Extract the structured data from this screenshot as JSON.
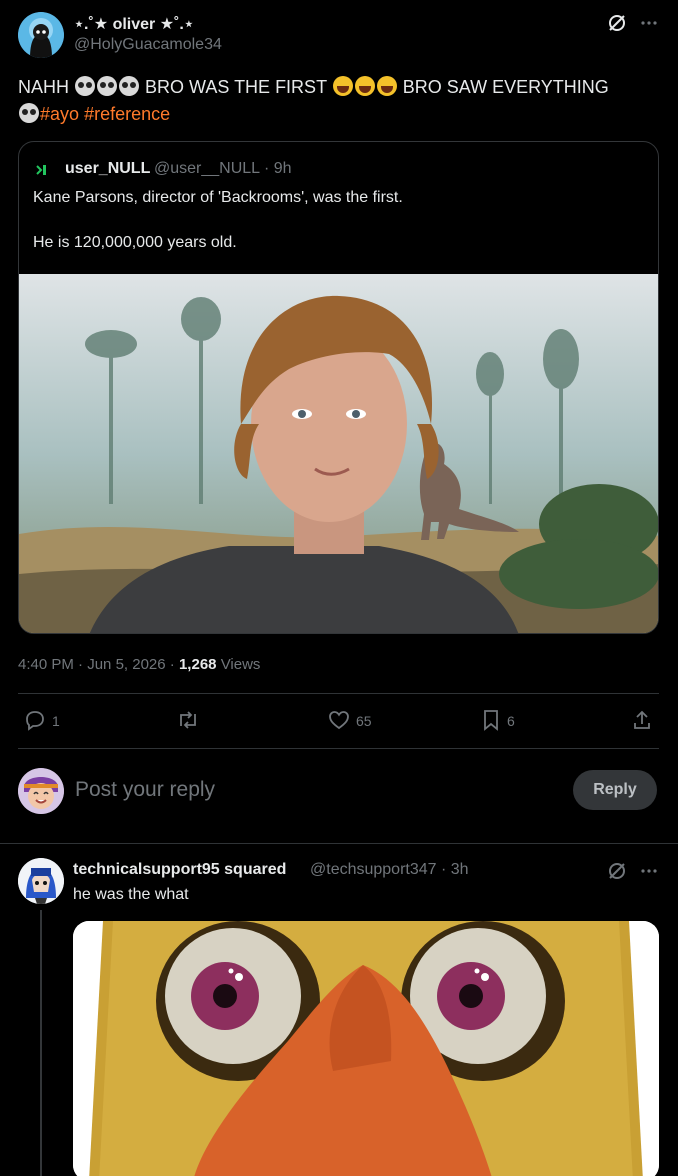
{
  "post": {
    "author_name": "⋆.˚★ oliver ★˚.⋆",
    "author_handle": "@HolyGuacamole34",
    "text_part1": "NAHH",
    "text_part2": "BRO WAS THE FIRST",
    "text_part3": "BRO SAW EVERYTHING",
    "hashtag1": "#ayo",
    "hashtag2": "#reference",
    "time": "4:40 PM",
    "date": "Jun 5, 2026",
    "views_count": "1,268",
    "views_label": "Views",
    "sep": "·"
  },
  "quote": {
    "author_name": "user_NULL",
    "author_handle": "@user__NULL",
    "age": "9h",
    "line1": "Kane Parsons, director of 'Backrooms', was the first.",
    "line2": "He is 120,000,000 years old."
  },
  "actions": {
    "replies": "1",
    "likes": "65",
    "bookmarks": "6"
  },
  "composer": {
    "placeholder": "Post your reply",
    "button": "Reply"
  },
  "comment": {
    "author_name": "technicalsupport95 squared",
    "author_handle": "@techsupport347",
    "age": "3h",
    "text": "he was the what"
  },
  "colors": {
    "accent_hashtag": "#ff7a2b",
    "muted": "#71767b",
    "background": "#000000",
    "border": "#2f3336"
  },
  "icons": [
    "grok-slash-icon",
    "more-icon",
    "reply-icon",
    "repost-icon",
    "like-icon",
    "bookmark-icon",
    "share-icon"
  ]
}
